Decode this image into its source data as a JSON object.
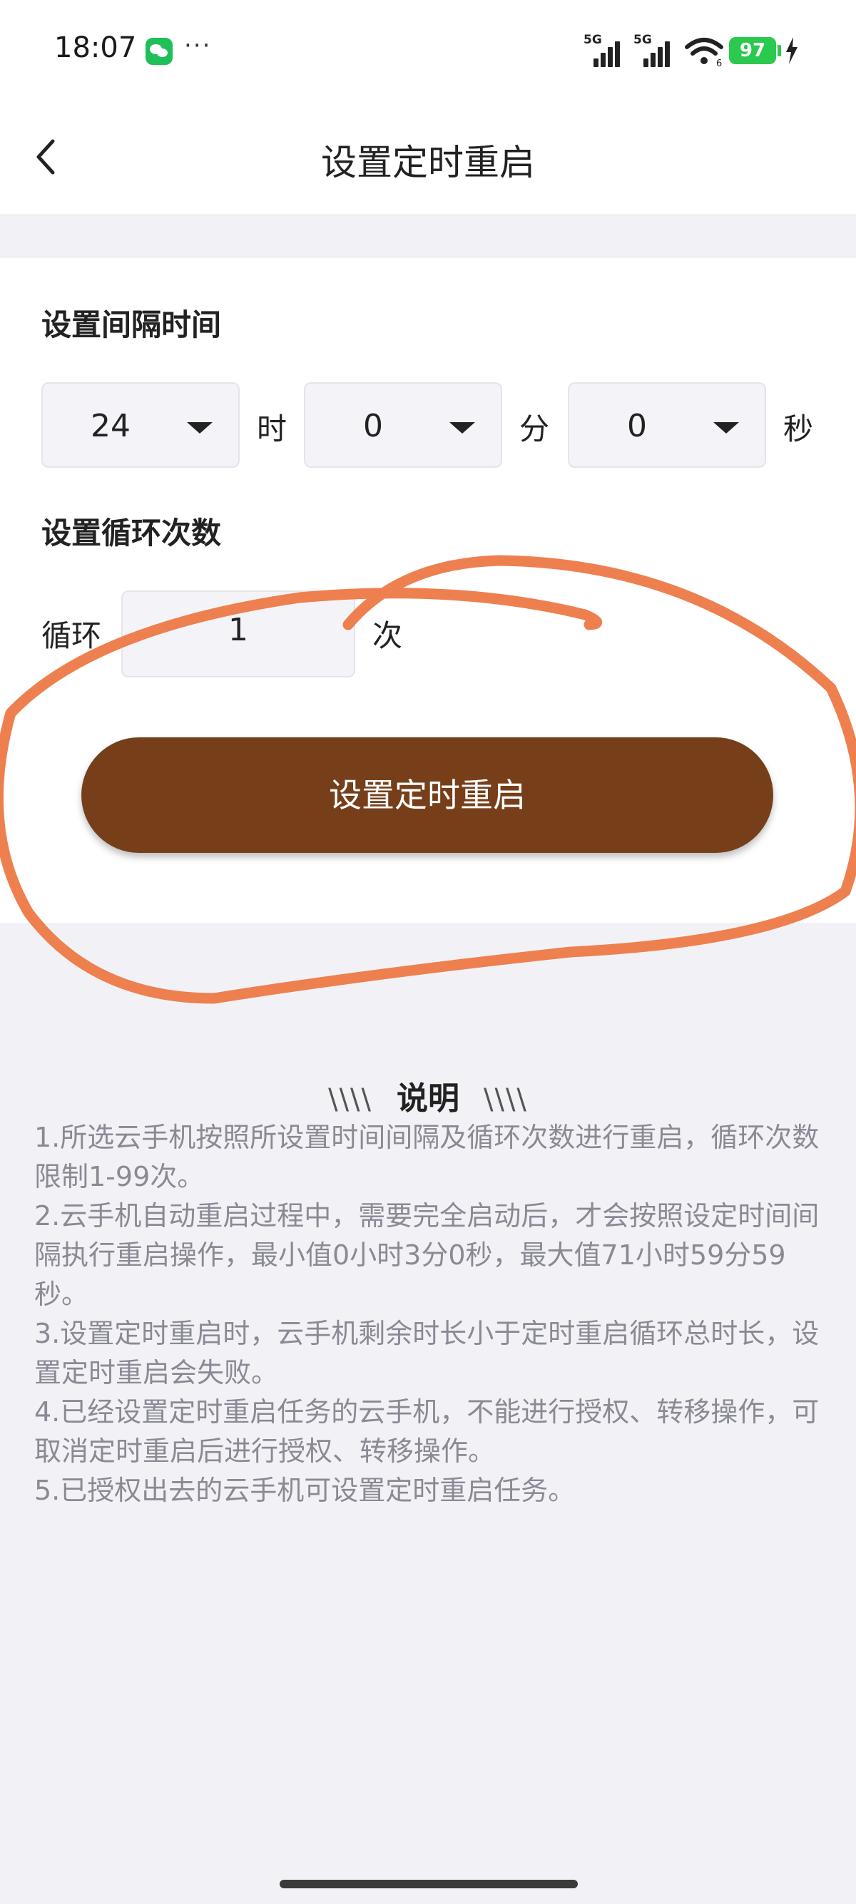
{
  "status_bar": {
    "time": "18:07",
    "more": "···",
    "signal1_label": "5G",
    "signal2_label": "5G",
    "wifi_badge": "6",
    "battery": "97"
  },
  "header": {
    "title": "设置定时重启"
  },
  "interval": {
    "title": "设置间隔时间",
    "hours_value": "24",
    "hours_unit": "时",
    "minutes_value": "0",
    "minutes_unit": "分",
    "seconds_value": "0",
    "seconds_unit": "秒"
  },
  "loop": {
    "title": "设置循环次数",
    "label": "循环",
    "value": "1",
    "unit": "次"
  },
  "submit_label": "设置定时重启",
  "notes": {
    "heading_slashes": "\\\\\\\\",
    "heading": "说明",
    "lines": [
      "1.所选云手机按照所设置时间间隔及循环次数进行重启，循环次数",
      "限制1-99次。",
      "2.云手机自动重启过程中，需要完全启动后，才会按照设定时间间",
      "隔执行重启操作，最小值0小时3分0秒，最大值71小时59分59",
      "秒。",
      "3.设置定时重启时，云手机剩余时长小于定时重启循环总时长，设",
      "置定时重启会失败。",
      "4.已经设置定时重启任务的云手机，不能进行授权、转移操作，可",
      "取消定时重启后进行授权、转移操作。",
      "5.已授权出去的云手机可设置定时重启任务。"
    ]
  },
  "colors": {
    "button": "#763f1a",
    "annotation": "#ee8050",
    "battery": "#2bc94e",
    "note_text": "#8a8a95"
  }
}
